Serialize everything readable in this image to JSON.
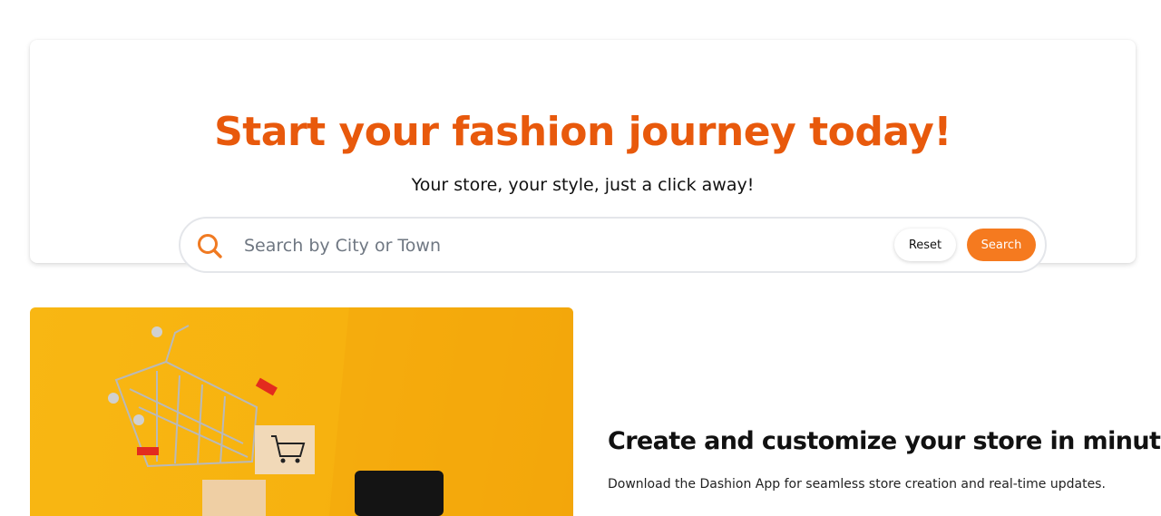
{
  "hero": {
    "title": "Start your fashion journey today!",
    "subtitle": "Your store, your style, just a click away!"
  },
  "search": {
    "placeholder": "Search by City or Town",
    "value": "",
    "reset_label": "Reset",
    "search_label": "Search",
    "icon": "search-icon"
  },
  "feature": {
    "title": "Create and customize your store in minutes!",
    "text": "Download the Dashion App for seamless store creation and real-time updates."
  },
  "colors": {
    "accent": "#e8590c",
    "search_button": "#f57a1f",
    "image_background": "#f8b713"
  }
}
